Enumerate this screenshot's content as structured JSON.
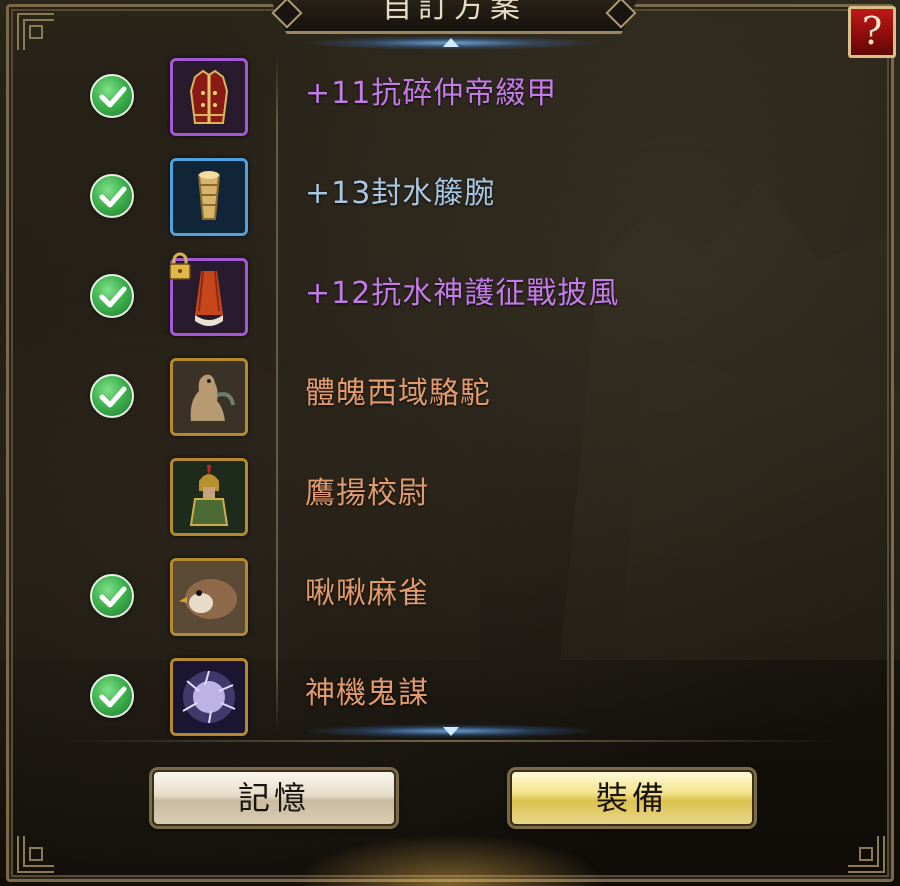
{
  "dialog": {
    "title": "自訂方案",
    "help_label": "?"
  },
  "items": [
    {
      "checked": true,
      "icon": "armor-vest-icon",
      "rarity": "purple",
      "locked": false,
      "name": "+11抗碎仲帝綴甲",
      "color": "#c37be8"
    },
    {
      "checked": true,
      "icon": "bracer-icon",
      "rarity": "blue",
      "locked": false,
      "name": "+13封水籐腕",
      "color": "#a9c7e2"
    },
    {
      "checked": true,
      "icon": "cape-icon",
      "rarity": "purple",
      "locked": true,
      "name": "+12抗水神護征戰披風",
      "color": "#c37be8"
    },
    {
      "checked": true,
      "icon": "camel-mount-icon",
      "rarity": "gold",
      "locked": false,
      "name": "體魄西域駱駝",
      "color": "#e09a6c"
    },
    {
      "checked": false,
      "icon": "soldier-icon",
      "rarity": "gold",
      "locked": false,
      "name": "鷹揚校尉",
      "color": "#e09a6c"
    },
    {
      "checked": true,
      "icon": "sparrow-icon",
      "rarity": "gold",
      "locked": false,
      "name": "啾啾麻雀",
      "color": "#e09a6c"
    },
    {
      "checked": true,
      "icon": "lightning-orb-icon",
      "rarity": "gold",
      "locked": false,
      "name": "神機鬼謀",
      "color": "#e09a6c"
    }
  ],
  "buttons": {
    "memory_label": "記憶",
    "equip_label": "裝備"
  },
  "colors": {
    "purple_text": "#c37be8",
    "blue_text": "#a9c7e2",
    "orange_text": "#e09a6c",
    "check_green": "#3fb34e"
  }
}
